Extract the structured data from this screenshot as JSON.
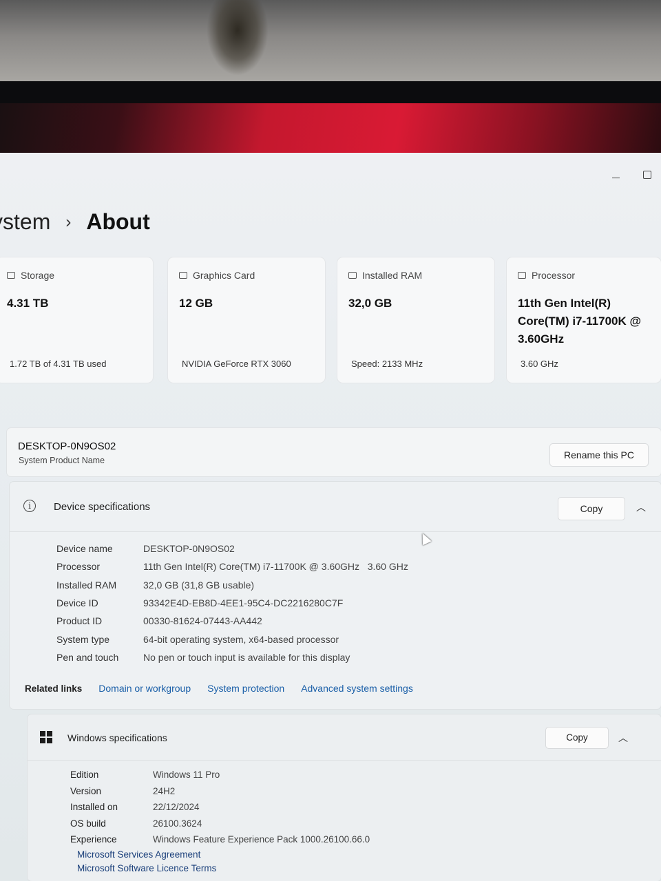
{
  "breadcrumb": {
    "parent": "ystem",
    "separator": "›",
    "current": "About"
  },
  "cards": [
    {
      "label": "Storage",
      "value": "4.31 TB",
      "sub": "1.72 TB of 4.31 TB used"
    },
    {
      "label": "Graphics Card",
      "value": "12 GB",
      "sub": "NVIDIA GeForce RTX 3060"
    },
    {
      "label": "Installed RAM",
      "value": "32,0 GB",
      "sub": "Speed: 2133 MHz"
    },
    {
      "label": "Processor",
      "value": "11th Gen Intel(R) Core(TM) i7-11700K @ 3.60GHz",
      "sub": "3.60 GHz"
    }
  ],
  "pc": {
    "name": "DESKTOP-0N9OS02",
    "label": "System Product Name",
    "rename_label": "Rename this PC"
  },
  "device_specs": {
    "title": "Device specifications",
    "copy_label": "Copy",
    "rows": [
      {
        "k": "Device name",
        "v": "DESKTOP-0N9OS02"
      },
      {
        "k": "Processor",
        "v": "11th Gen Intel(R) Core(TM) i7-11700K @ 3.60GHz   3.60 GHz"
      },
      {
        "k": "Installed RAM",
        "v": "32,0 GB (31,8 GB usable)"
      },
      {
        "k": "Device ID",
        "v": "93342E4D-EB8D-4EE1-95C4-DC2216280C7F"
      },
      {
        "k": "Product ID",
        "v": "00330-81624-07443-AA442"
      },
      {
        "k": "System type",
        "v": "64-bit operating system, x64-based processor"
      },
      {
        "k": "Pen and touch",
        "v": "No pen or touch input is available for this display"
      }
    ]
  },
  "related": {
    "label": "Related links",
    "links": [
      "Domain or workgroup",
      "System protection",
      "Advanced system settings"
    ]
  },
  "windows_specs": {
    "title": "Windows specifications",
    "copy_label": "Copy",
    "rows": [
      {
        "k": "Edition",
        "v": "Windows 11 Pro"
      },
      {
        "k": "Version",
        "v": "24H2"
      },
      {
        "k": "Installed on",
        "v": "22/12/2024"
      },
      {
        "k": "OS build",
        "v": "26100.3624"
      },
      {
        "k": "Experience",
        "v": "Windows Feature Experience Pack 1000.26100.66.0"
      }
    ],
    "links": [
      "Microsoft Services Agreement",
      "Microsoft Software Licence Terms"
    ]
  }
}
